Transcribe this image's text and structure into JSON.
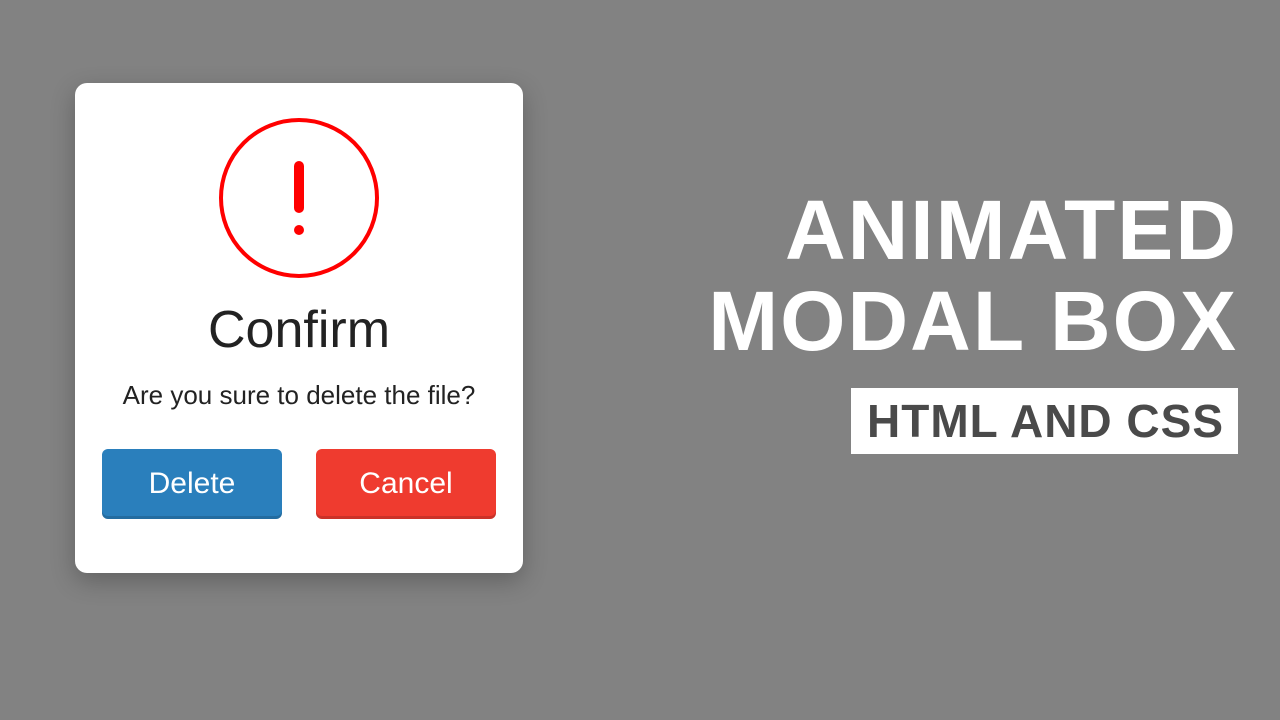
{
  "modal": {
    "icon": "exclamation",
    "title": "Confirm",
    "message": "Are you sure to delete the file?",
    "buttons": {
      "delete": "Delete",
      "cancel": "Cancel"
    }
  },
  "hero": {
    "line1": "ANIMATED",
    "line2": "MODAL BOX",
    "subtitle": "HTML AND CSS"
  },
  "colors": {
    "background": "#828282",
    "alert": "#ff0000",
    "delete_btn": "#2a7fbc",
    "cancel_btn": "#ef3b2f"
  }
}
